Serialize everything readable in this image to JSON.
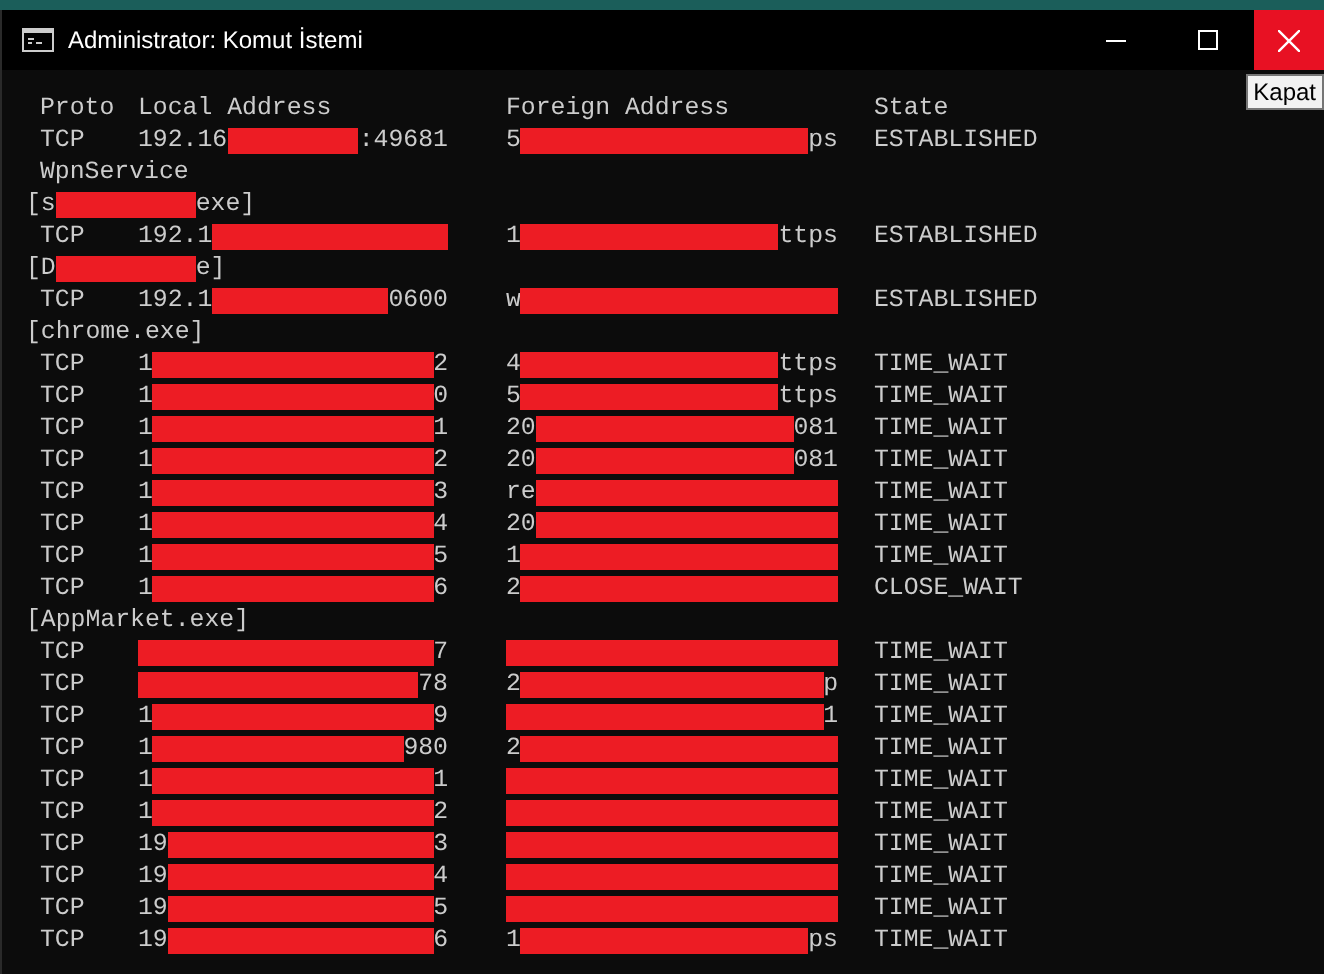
{
  "window": {
    "title": "Administrator: Komut İstemi",
    "close_tooltip": "Kapat"
  },
  "columns": [
    "Proto",
    "Local Address",
    "Foreign Address",
    "State"
  ],
  "lines": [
    {
      "kind": "conn",
      "proto": "TCP",
      "local": {
        "before": "192.16",
        "after": ":49681"
      },
      "foreign": {
        "before": "5",
        "after": "ps"
      },
      "state": "ESTABLISHED"
    },
    {
      "kind": "service",
      "text": "WpnService"
    },
    {
      "kind": "process",
      "before": "[s",
      "after": "exe]"
    },
    {
      "kind": "conn",
      "proto": "TCP",
      "local": {
        "before": "192.1"
      },
      "foreign": {
        "before": "1",
        "after": "ttps"
      },
      "state": "ESTABLISHED"
    },
    {
      "kind": "process",
      "before": "[D",
      "after": "e]"
    },
    {
      "kind": "conn",
      "proto": "TCP",
      "local": {
        "before": "192.1",
        "after": "0600"
      },
      "foreign": {
        "before": "w"
      },
      "state": "ESTABLISHED"
    },
    {
      "kind": "process",
      "before": "[chrome.exe]"
    },
    {
      "kind": "conn",
      "proto": "TCP",
      "local": {
        "before": "1",
        "after": "2"
      },
      "foreign": {
        "before": "4",
        "after": "ttps"
      },
      "state": "TIME_WAIT"
    },
    {
      "kind": "conn",
      "proto": "TCP",
      "local": {
        "before": "1",
        "after": "0"
      },
      "foreign": {
        "before": "5",
        "after": "ttps"
      },
      "state": "TIME_WAIT"
    },
    {
      "kind": "conn",
      "proto": "TCP",
      "local": {
        "before": "1",
        "after": "1"
      },
      "foreign": {
        "before": "20",
        "after": "081"
      },
      "state": "TIME_WAIT"
    },
    {
      "kind": "conn",
      "proto": "TCP",
      "local": {
        "before": "1",
        "after": "2"
      },
      "foreign": {
        "before": "20",
        "after": "081"
      },
      "state": "TIME_WAIT"
    },
    {
      "kind": "conn",
      "proto": "TCP",
      "local": {
        "before": "1",
        "after": "3"
      },
      "foreign": {
        "before": "re"
      },
      "state": "TIME_WAIT"
    },
    {
      "kind": "conn",
      "proto": "TCP",
      "local": {
        "before": "1",
        "after": "4"
      },
      "foreign": {
        "before": "20"
      },
      "state": "TIME_WAIT"
    },
    {
      "kind": "conn",
      "proto": "TCP",
      "local": {
        "before": "1",
        "after": "5"
      },
      "foreign": {
        "before": "1"
      },
      "state": "TIME_WAIT"
    },
    {
      "kind": "conn",
      "proto": "TCP",
      "local": {
        "before": "1",
        "after": "6"
      },
      "foreign": {
        "before": "2"
      },
      "state": "CLOSE_WAIT"
    },
    {
      "kind": "process",
      "before": "[AppMarket.exe]"
    },
    {
      "kind": "conn",
      "proto": "TCP",
      "local": {
        "after": "7"
      },
      "state": "TIME_WAIT"
    },
    {
      "kind": "conn",
      "proto": "TCP",
      "local": {
        "after": "78"
      },
      "foreign": {
        "before": "2",
        "after": "p"
      },
      "state": "TIME_WAIT"
    },
    {
      "kind": "conn",
      "proto": "TCP",
      "local": {
        "before": "1",
        "after": "9"
      },
      "foreign": {
        "after": "1"
      },
      "state": "TIME_WAIT"
    },
    {
      "kind": "conn",
      "proto": "TCP",
      "local": {
        "before": "1",
        "after": "980"
      },
      "foreign": {
        "before": "2"
      },
      "state": "TIME_WAIT"
    },
    {
      "kind": "conn",
      "proto": "TCP",
      "local": {
        "before": "1",
        "after": "1"
      },
      "state": "TIME_WAIT"
    },
    {
      "kind": "conn",
      "proto": "TCP",
      "local": {
        "before": "1",
        "after": "2"
      },
      "state": "TIME_WAIT"
    },
    {
      "kind": "conn",
      "proto": "TCP",
      "local": {
        "before": "19",
        "after": "3"
      },
      "state": "TIME_WAIT"
    },
    {
      "kind": "conn",
      "proto": "TCP",
      "local": {
        "before": "19",
        "after": "4"
      },
      "state": "TIME_WAIT"
    },
    {
      "kind": "conn",
      "proto": "TCP",
      "local": {
        "before": "19",
        "after": "5"
      },
      "state": "TIME_WAIT"
    },
    {
      "kind": "conn",
      "proto": "TCP",
      "local": {
        "before": "19",
        "after": "6"
      },
      "foreign": {
        "before": "1",
        "after": "ps"
      },
      "state": "TIME_WAIT"
    }
  ]
}
